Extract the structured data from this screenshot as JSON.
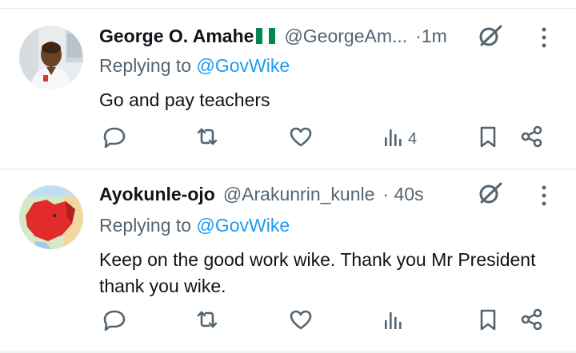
{
  "tweets": [
    {
      "name": "George O. Amahe",
      "handle": "@GeorgeAm...",
      "time": "·1m",
      "replying_prefix": "Replying to ",
      "replying_to": "@GovWike",
      "text": "Go and pay teachers",
      "views": "4",
      "flag": "nigeria-flag"
    },
    {
      "name": "Ayokunle-ojo",
      "handle": "@Arakunrin_kunle",
      "time": "· 40s",
      "replying_prefix": "Replying to ",
      "replying_to": "@GovWike",
      "text": "Keep on the good work wike. Thank you Mr President thank you wike.",
      "views": ""
    }
  ],
  "icons": [
    "reply-icon",
    "retweet-icon",
    "like-icon",
    "views-icon",
    "bookmark-icon",
    "share-icon",
    "grok-icon",
    "more-icon"
  ],
  "colors": {
    "link": "#1d9bf0",
    "secondary": "#536471",
    "text": "#0f1419",
    "flag_green": "#008751"
  }
}
